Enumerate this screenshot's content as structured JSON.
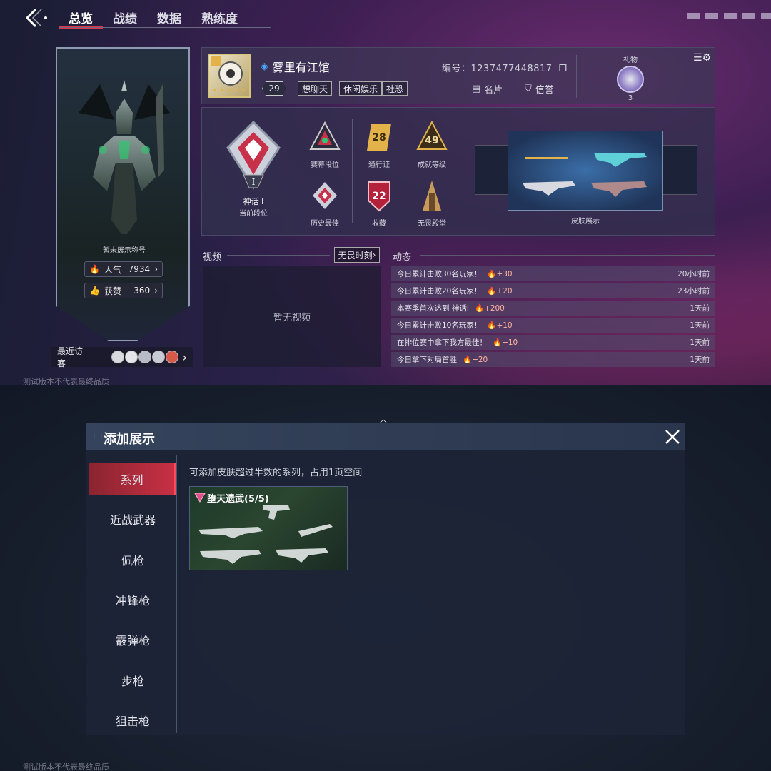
{
  "nav": {
    "tabs": [
      "总览",
      "战绩",
      "数据",
      "熟练度"
    ],
    "active_tab": 0
  },
  "left_card": {
    "title_placeholder": "暂未展示称号",
    "popularity_label": "人气",
    "popularity_value": "7934",
    "likes_label": "获赞",
    "likes_value": "360",
    "visitors_label": "最近访客"
  },
  "profile": {
    "name": "雾里有江馆",
    "level": "29",
    "tags": [
      "想聊天",
      "休闲娱乐",
      "社恐"
    ],
    "id_label": "编号：",
    "id_value": "1237477448817",
    "card_button": "名片",
    "reputation_button": "信誉",
    "gift_label": "礼物",
    "gift_count": "3"
  },
  "ranks": {
    "current_rank_name": "神话 I",
    "current_rank_caption": "当前段位",
    "season_rank": "赛幕段位",
    "history_best": "历史最佳",
    "battle_pass_value": "28",
    "battle_pass": "通行证",
    "achievement_value": "49",
    "achievement": "成就等级",
    "collection_value": "22",
    "collection": "收藏",
    "hall": "无畏殿堂",
    "skin_display": "皮肤展示"
  },
  "video": {
    "title": "视频",
    "button": "无畏时刻",
    "empty": "暂无视频"
  },
  "dynamics": {
    "title": "动态",
    "items": [
      {
        "text": "今日累计击败30名玩家！",
        "gain": "+30",
        "time": "20小时前"
      },
      {
        "text": "今日累计击败20名玩家！",
        "gain": "+20",
        "time": "23小时前"
      },
      {
        "text": "本赛季首次达到 神话I",
        "gain": "+200",
        "time": "1天前"
      },
      {
        "text": "今日累计击败10名玩家！",
        "gain": "+10",
        "time": "1天前"
      },
      {
        "text": "在排位赛中拿下我方最佳！",
        "gain": "+10",
        "time": "1天前"
      },
      {
        "text": "今日拿下对局首胜",
        "gain": "+20",
        "time": "1天前"
      }
    ]
  },
  "watermark": "测试版本不代表最终品质",
  "dialog": {
    "title": "添加展示",
    "hint": "可添加皮肤超过半数的系列，占用1页空间",
    "categories": [
      "系列",
      "近战武器",
      "佩枪",
      "冲锋枪",
      "霰弹枪",
      "步枪",
      "狙击枪"
    ],
    "active_category": 0,
    "series_card_title": "堕天遗武(5/5)"
  },
  "colors": {
    "accent_red": "#e0334a",
    "fire": "#ff6a3d",
    "gold": "#e3b34a"
  }
}
